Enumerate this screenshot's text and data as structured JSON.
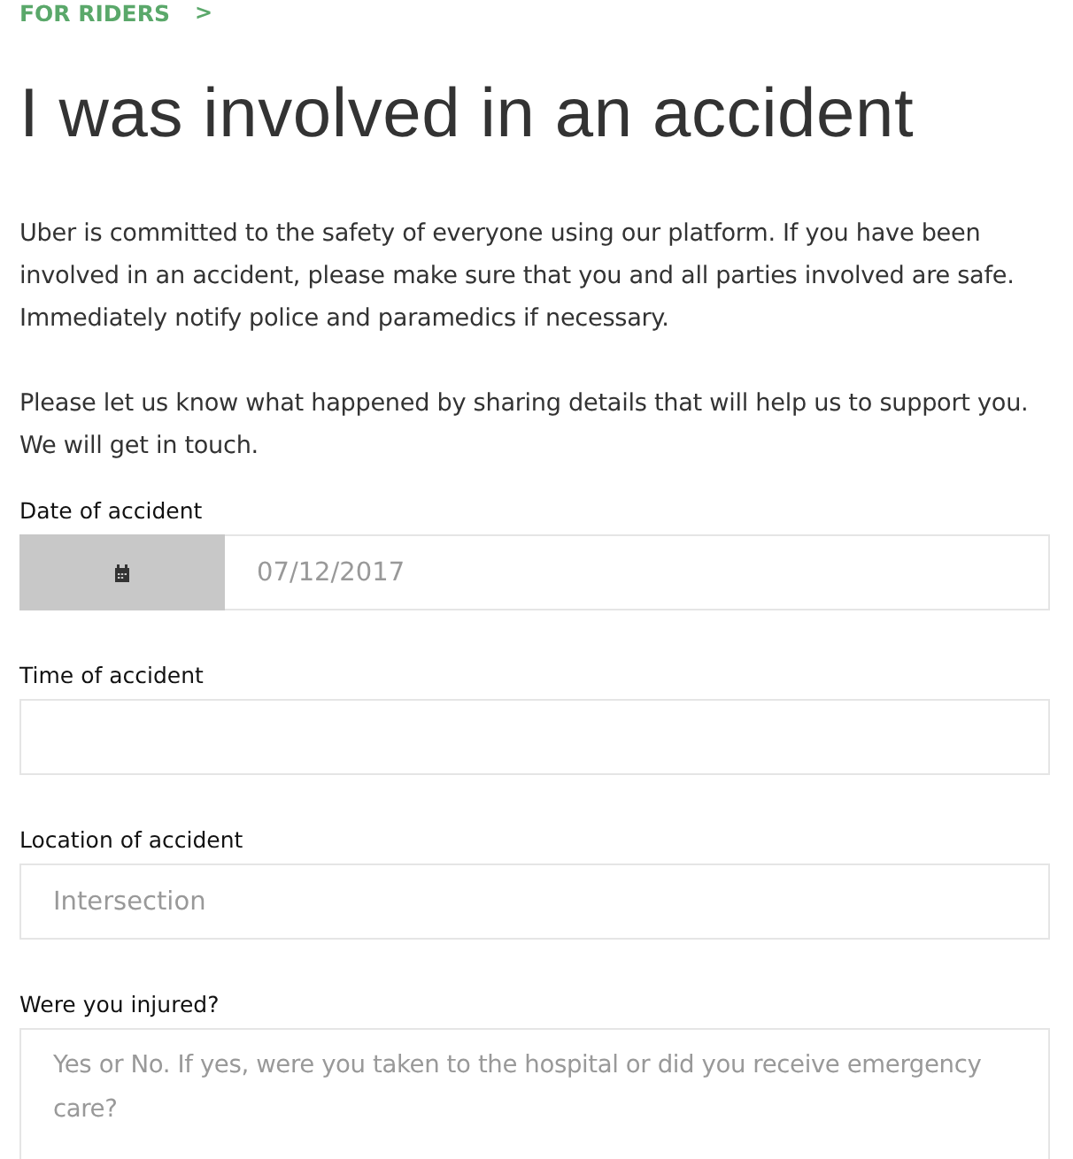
{
  "breadcrumb": {
    "label": "FOR RIDERS",
    "chevron": ">"
  },
  "title": "I was involved in an accident",
  "paragraphs": [
    "Uber is committed to the safety of everyone using our platform. If you have been involved in an accident, please make sure that you and all parties involved are safe. Immediately notify police and paramedics if necessary.",
    "Please let us know what happened by sharing details that will help us to support you. We will get in touch."
  ],
  "fields": [
    {
      "kind": "date",
      "label": "Date of accident",
      "placeholder": "07/12/2017"
    },
    {
      "kind": "text",
      "label": "Time of accident"
    },
    {
      "kind": "text",
      "label": "Location of accident",
      "placeholder": "Intersection"
    },
    {
      "kind": "textarea",
      "label": "Were you injured?",
      "placeholder": "Yes or No. If yes, were you taken to the hospital or did you receive emergency care?"
    }
  ]
}
